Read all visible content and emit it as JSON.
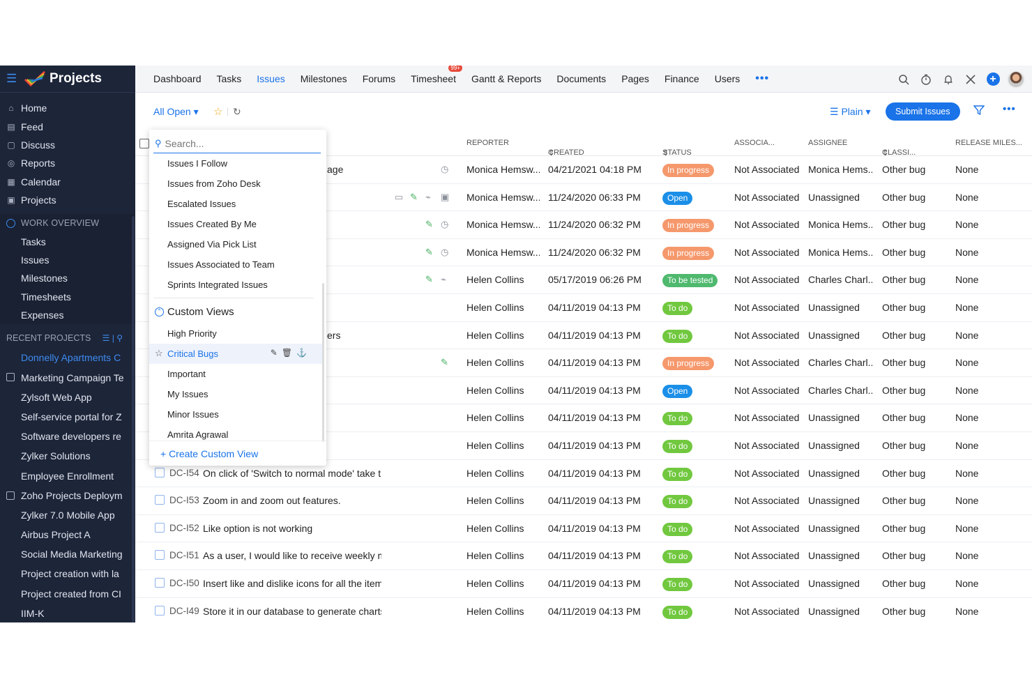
{
  "app": {
    "title": "Projects"
  },
  "sidebar": {
    "main_nav": [
      {
        "label": "Home",
        "icon": "home-icon"
      },
      {
        "label": "Feed",
        "icon": "feed-icon"
      },
      {
        "label": "Discuss",
        "icon": "discuss-icon"
      },
      {
        "label": "Reports",
        "icon": "reports-icon"
      },
      {
        "label": "Calendar",
        "icon": "calendar-icon"
      },
      {
        "label": "Projects",
        "icon": "projects-icon"
      }
    ],
    "work_overview_label": "WORK OVERVIEW",
    "work_overview_items": [
      "Tasks",
      "Issues",
      "Milestones",
      "Timesheets",
      "Expenses"
    ],
    "recent_projects_label": "RECENT PROJECTS",
    "recent_projects": [
      {
        "label": "Donnelly Apartments C",
        "active": true,
        "icon": false
      },
      {
        "label": "Marketing Campaign Te",
        "active": false,
        "icon": true
      },
      {
        "label": "Zylsoft Web App",
        "active": false,
        "icon": false
      },
      {
        "label": "Self-service portal for Z",
        "active": false,
        "icon": false
      },
      {
        "label": "Software developers re",
        "active": false,
        "icon": false
      },
      {
        "label": "Zylker Solutions",
        "active": false,
        "icon": false
      },
      {
        "label": "Employee Enrollment",
        "active": false,
        "icon": false
      },
      {
        "label": "Zoho Projects Deploym",
        "active": false,
        "icon": true
      },
      {
        "label": "Zylker 7.0 Mobile App",
        "active": false,
        "icon": false
      },
      {
        "label": "Airbus Project A",
        "active": false,
        "icon": false
      },
      {
        "label": "Social Media Marketing",
        "active": false,
        "icon": false
      },
      {
        "label": "Project creation with la",
        "active": false,
        "icon": false
      },
      {
        "label": "Project created from CI",
        "active": false,
        "icon": false
      },
      {
        "label": "IIM-K",
        "active": false,
        "icon": false
      }
    ]
  },
  "topbar": {
    "tabs": [
      "Dashboard",
      "Tasks",
      "Issues",
      "Milestones",
      "Forums",
      "Timesheet",
      "Gantt & Reports",
      "Documents",
      "Pages",
      "Finance",
      "Users"
    ],
    "active_tab": "Issues",
    "timesheet_badge": "99+",
    "more": "•••"
  },
  "toolbar": {
    "view_label": "All Open",
    "plain_label": "Plain",
    "submit_label": "Submit Issues",
    "more": "•••"
  },
  "table": {
    "headers": {
      "reporter": "REPORTER",
      "created": "CREATED",
      "status": "STATUS",
      "associated": "ASSOCIA...",
      "assignee": "ASSIGNEE",
      "classification": "CLASSI...",
      "release": "RELEASE MILES..."
    },
    "rows": [
      {
        "id": "",
        "title": "age",
        "reporter": "Monica Hemsw...",
        "created": "04/21/2021 04:18 PM",
        "status": "In progress",
        "associated": "Not Associated",
        "assignee": "Monica Hems...",
        "classification": "Other bug",
        "release": "None"
      },
      {
        "id": "",
        "title": "",
        "reporter": "Monica Hemsw...",
        "created": "11/24/2020 06:33 PM",
        "status": "Open",
        "associated": "Not Associated",
        "assignee": "Unassigned",
        "classification": "Other bug",
        "release": "None"
      },
      {
        "id": "",
        "title": "",
        "reporter": "Monica Hemsw...",
        "created": "11/24/2020 06:32 PM",
        "status": "In progress",
        "associated": "Not Associated",
        "assignee": "Monica Hems...",
        "classification": "Other bug",
        "release": "None"
      },
      {
        "id": "",
        "title": "",
        "reporter": "Monica Hemsw...",
        "created": "11/24/2020 06:32 PM",
        "status": "In progress",
        "associated": "Not Associated",
        "assignee": "Monica Hems...",
        "classification": "Other bug",
        "release": "None"
      },
      {
        "id": "",
        "title": "",
        "reporter": "Helen Collins",
        "created": "05/17/2019 06:26 PM",
        "status": "To be tested",
        "associated": "Not Associated",
        "assignee": "Charles Charl...",
        "classification": "Other bug",
        "release": "None"
      },
      {
        "id": "",
        "title": "",
        "reporter": "Helen Collins",
        "created": "04/11/2019 04:13 PM",
        "status": "To do",
        "associated": "Not Associated",
        "assignee": "Unassigned",
        "classification": "Other bug",
        "release": "None"
      },
      {
        "id": "",
        "title": "ers",
        "reporter": "Helen Collins",
        "created": "04/11/2019 04:13 PM",
        "status": "To do",
        "associated": "Not Associated",
        "assignee": "Unassigned",
        "classification": "Other bug",
        "release": "None"
      },
      {
        "id": "",
        "title": "",
        "reporter": "Helen Collins",
        "created": "04/11/2019 04:13 PM",
        "status": "In progress",
        "associated": "Not Associated",
        "assignee": "Charles Charl...",
        "classification": "Other bug",
        "release": "None"
      },
      {
        "id": "",
        "title": "",
        "reporter": "Helen Collins",
        "created": "04/11/2019 04:13 PM",
        "status": "Open",
        "associated": "Not Associated",
        "assignee": "Charles Charl...",
        "classification": "Other bug",
        "release": "None"
      },
      {
        "id": "",
        "title": "",
        "reporter": "Helen Collins",
        "created": "04/11/2019 04:13 PM",
        "status": "To do",
        "associated": "Not Associated",
        "assignee": "Unassigned",
        "classification": "Other bug",
        "release": "None"
      },
      {
        "id": "",
        "title": "",
        "reporter": "Helen Collins",
        "created": "04/11/2019 04:13 PM",
        "status": "To do",
        "associated": "Not Associated",
        "assignee": "Unassigned",
        "classification": "Other bug",
        "release": "None"
      },
      {
        "id": "DC-I54",
        "title": "On click of 'Switch to normal mode' take the",
        "reporter": "Helen Collins",
        "created": "04/11/2019 04:13 PM",
        "status": "To do",
        "associated": "Not Associated",
        "assignee": "Unassigned",
        "classification": "Other bug",
        "release": "None"
      },
      {
        "id": "DC-I53",
        "title": "Zoom in and zoom out features.",
        "reporter": "Helen Collins",
        "created": "04/11/2019 04:13 PM",
        "status": "To do",
        "associated": "Not Associated",
        "assignee": "Unassigned",
        "classification": "Other bug",
        "release": "None"
      },
      {
        "id": "DC-I52",
        "title": "Like option is not working",
        "reporter": "Helen Collins",
        "created": "04/11/2019 04:13 PM",
        "status": "To do",
        "associated": "Not Associated",
        "assignee": "Unassigned",
        "classification": "Other bug",
        "release": "None"
      },
      {
        "id": "DC-I51",
        "title": "As a user, I would like to receive weekly mail",
        "reporter": "Helen Collins",
        "created": "04/11/2019 04:13 PM",
        "status": "To do",
        "associated": "Not Associated",
        "assignee": "Unassigned",
        "classification": "Other bug",
        "release": "None"
      },
      {
        "id": "DC-I50",
        "title": "Insert like and dislike icons for all the items.",
        "reporter": "Helen Collins",
        "created": "04/11/2019 04:13 PM",
        "status": "To do",
        "associated": "Not Associated",
        "assignee": "Unassigned",
        "classification": "Other bug",
        "release": "None"
      },
      {
        "id": "DC-I49",
        "title": "Store it in our database to generate charts or",
        "reporter": "Helen Collins",
        "created": "04/11/2019 04:13 PM",
        "status": "To do",
        "associated": "Not Associated",
        "assignee": "Unassigned",
        "classification": "Other bug",
        "release": "None"
      }
    ]
  },
  "dropdown": {
    "search_placeholder": "Search...",
    "items": [
      "Issues I Follow",
      "Issues from Zoho Desk",
      "Escalated Issues",
      "Issues Created By Me",
      "Assigned Via Pick List",
      "Issues Associated to Team",
      "Sprints Integrated Issues"
    ],
    "custom_views_label": "Custom Views",
    "custom_views": [
      "High Priority",
      "Critical Bugs",
      "Important",
      "My Issues",
      "Minor Issues",
      "Amrita Agrawal"
    ],
    "selected": "Critical Bugs",
    "create_label": "+ Create Custom View"
  },
  "colors": {
    "sidebar_bg": "#1d2539",
    "accent": "#1a73e8",
    "in_progress": "#f5986c",
    "open": "#1b8fe8",
    "to_be_tested": "#4fb96e",
    "to_do": "#71c83f"
  }
}
